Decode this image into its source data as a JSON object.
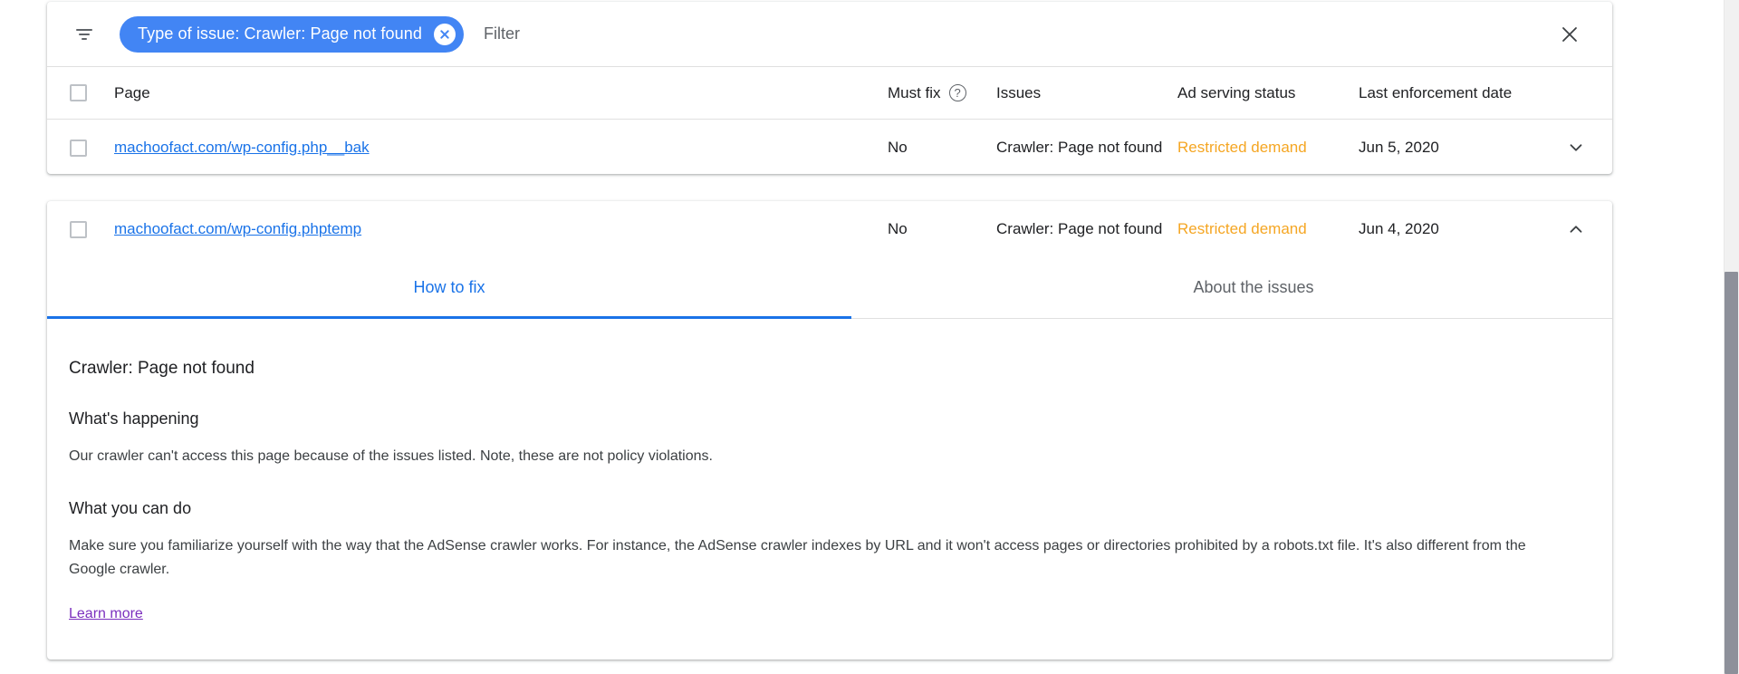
{
  "filter_bar": {
    "filter_icon": "filter-list-icon",
    "chip": {
      "label": "Type of issue: Crawler: Page not found",
      "remove_glyph": "✕",
      "bg_color": "#4285f4",
      "text_color": "#ffffff"
    },
    "placeholder": "Filter",
    "close_glyph": "✕"
  },
  "table": {
    "columns": {
      "page": "Page",
      "must_fix": "Must fix",
      "must_fix_help": "?",
      "issues": "Issues",
      "ad_serving_status": "Ad serving status",
      "last_enforcement_date": "Last enforcement date"
    },
    "rows": [
      {
        "page": "machoofact.com/wp-config.php__bak",
        "must_fix": "No",
        "issues": "Crawler: Page not found",
        "ad_serving_status": "Restricted demand",
        "last_enforcement_date": "Jun 5, 2020",
        "expanded": false,
        "expand_glyph": "chevron-down-icon"
      },
      {
        "page": "machoofact.com/wp-config.phptemp",
        "must_fix": "No",
        "issues": "Crawler: Page not found",
        "ad_serving_status": "Restricted demand",
        "last_enforcement_date": "Jun 4, 2020",
        "expanded": true,
        "expand_glyph": "chevron-up-icon"
      }
    ]
  },
  "detail": {
    "tabs": [
      {
        "label": "How to fix",
        "active": true
      },
      {
        "label": "About the issues",
        "active": false
      }
    ],
    "title": "Crawler: Page not found",
    "sections": [
      {
        "heading": "What's happening",
        "body": "Our crawler can't access this page because of the issues listed. Note, these are not policy violations."
      },
      {
        "heading": "What you can do",
        "body": "Make sure you familiarize yourself with the way that the AdSense crawler works. For instance, the AdSense crawler indexes by URL and it won't access pages or directories prohibited by a robots.txt file. It's also different from the Google crawler."
      }
    ],
    "learn_more": "Learn more"
  },
  "colors": {
    "accent": "#1a73e8",
    "chip": "#4285f4",
    "warning": "#f5a623",
    "visited_link": "#7b2fbe"
  }
}
